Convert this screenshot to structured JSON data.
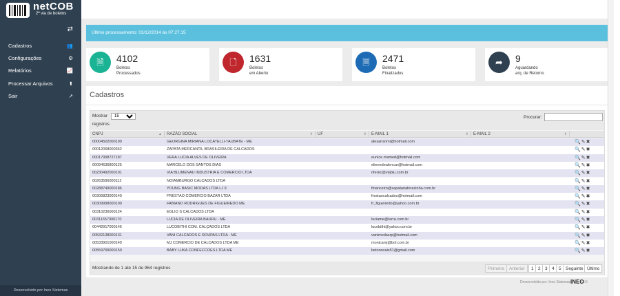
{
  "app": {
    "name": "netCOB",
    "subtitle": "2ª via de boletos",
    "toggle_glyph": "⇄"
  },
  "sidebar": {
    "items": [
      {
        "label": "Cadastros",
        "icon": "users-icon",
        "glyph": "👥"
      },
      {
        "label": "Configurações",
        "icon": "cogs-icon",
        "glyph": "⚙"
      },
      {
        "label": "Relatórios",
        "icon": "chart-icon",
        "glyph": "📈"
      },
      {
        "label": "Processar Arquivos",
        "icon": "upload-icon",
        "glyph": "⬆"
      },
      {
        "label": "Sair",
        "icon": "external-link-icon",
        "glyph": "↗"
      }
    ],
    "footer": "Desenvolvido por Ineo Sistemas"
  },
  "alert": {
    "text": "Último processamento: 03/12/2014 às 07:27:15",
    "color": "#5bc0de"
  },
  "stats": [
    {
      "value": "4102",
      "line1": "Boletos",
      "line2": "Processados",
      "color": "#1ab394",
      "icon": "file-icon",
      "glyph": "🗎"
    },
    {
      "value": "1631",
      "line1": "Boletos",
      "line2": "em Aberto",
      "color": "#c0272d",
      "icon": "file-open-icon",
      "glyph": "🗋"
    },
    {
      "value": "2471",
      "line1": "Boletos",
      "line2": "Finalizados",
      "color": "#1c6bb4",
      "icon": "file-text-icon",
      "glyph": "🗏"
    },
    {
      "value": "9",
      "line1": "Aguardando",
      "line2": "arq. de Retorno",
      "color": "#2f4050",
      "icon": "reply-icon",
      "glyph": "➦"
    }
  ],
  "panel": {
    "title": "Cadastros"
  },
  "table": {
    "show_label": "Mostrar",
    "show_value": "15",
    "records_label": "registros",
    "search_label": "Procurar:",
    "search_value": "",
    "columns": [
      "CNPJ",
      "RAZÃO SOCIAL",
      "UF",
      "E-MAIL 1",
      "E-MAIL 2"
    ],
    "rows": [
      [
        "00004502000190",
        "GEORGINA MIRIANA LOCATELLI-TAUBATE - ME",
        "",
        "alesansomi@hotmail.com",
        ""
      ],
      [
        "00012068000352",
        "ZAPATA MERCANTIL BRASILEIRA DE CALCADOS",
        "",
        "",
        ""
      ],
      [
        "00017998727187",
        "VERA LÚCIA ALVES DE OLIVEIRA",
        "",
        "eunice.mamed@hotmail.com",
        ""
      ],
      [
        "00094636800125",
        "MARCELO DOS SANTOS DIAS",
        "",
        "elienedealencar@hotmail.com",
        ""
      ],
      [
        "00230492000101",
        "VIA BLUMENAU INDUSTRIA E COMERCIO LTDA",
        "",
        "nferec@viablu.com.br",
        ""
      ],
      [
        "00263596000112",
        "NOIAMBURGO CALCADOS LTDA",
        "",
        "",
        ""
      ],
      [
        "00288749000186",
        "YOUNG BASIC MODAS LTDA LJ 9",
        "",
        "financeiro@sapatariaferezinha.com.br",
        ""
      ],
      [
        "00306823000140",
        "FRESTÃO COMERCIO BAZAR LTDA",
        "",
        "frestaocalcados@hotmail.com",
        ""
      ],
      [
        "00309998000100",
        "FABIANO RODRIGUES DE FIGUEIREDO ME",
        "",
        "fr_figueiredo@yahoo.com.br",
        ""
      ],
      [
        "00310236000124",
        "EGLIO S CALCADOS LTDA",
        "",
        "",
        ""
      ],
      [
        "00311657000170",
        "LUCIA DE OLIVEIRA BAURU - ME",
        "",
        "luciame@terra.com.br",
        ""
      ],
      [
        "00442917000146",
        "LUCOBITHI COM. CALÇADOS LTDA",
        "",
        "lucobithi@yahoo.com.br",
        ""
      ],
      [
        "00532138000131",
        "VANI CALCADOS E ROUPAS LTDA - ME",
        "",
        "vanimodasrp@hotmail.com",
        ""
      ],
      [
        "00533901000149",
        "MJ COMERCIO DE CALCADOS LTDA ME",
        "",
        "monicamj@bol.com.br",
        ""
      ],
      [
        "00559799000150",
        "BABY LUKA CONFECCOES LTDA ME",
        "",
        "betonovais51@gmail.com",
        ""
      ]
    ],
    "actions": {
      "view": "🔍",
      "edit": "✎",
      "delete": "✖"
    },
    "info": "Mostrando de 1 até 15 de 964 registros",
    "pagination": [
      "Primeiro",
      "Anterior",
      "1",
      "2",
      "3",
      "4",
      "5",
      "Seguinte",
      "Último"
    ]
  },
  "footer": {
    "copyright": "Desenvolvido por: Ineo Sistemas - v. 1.4.0.5",
    "brand": "INEO"
  }
}
